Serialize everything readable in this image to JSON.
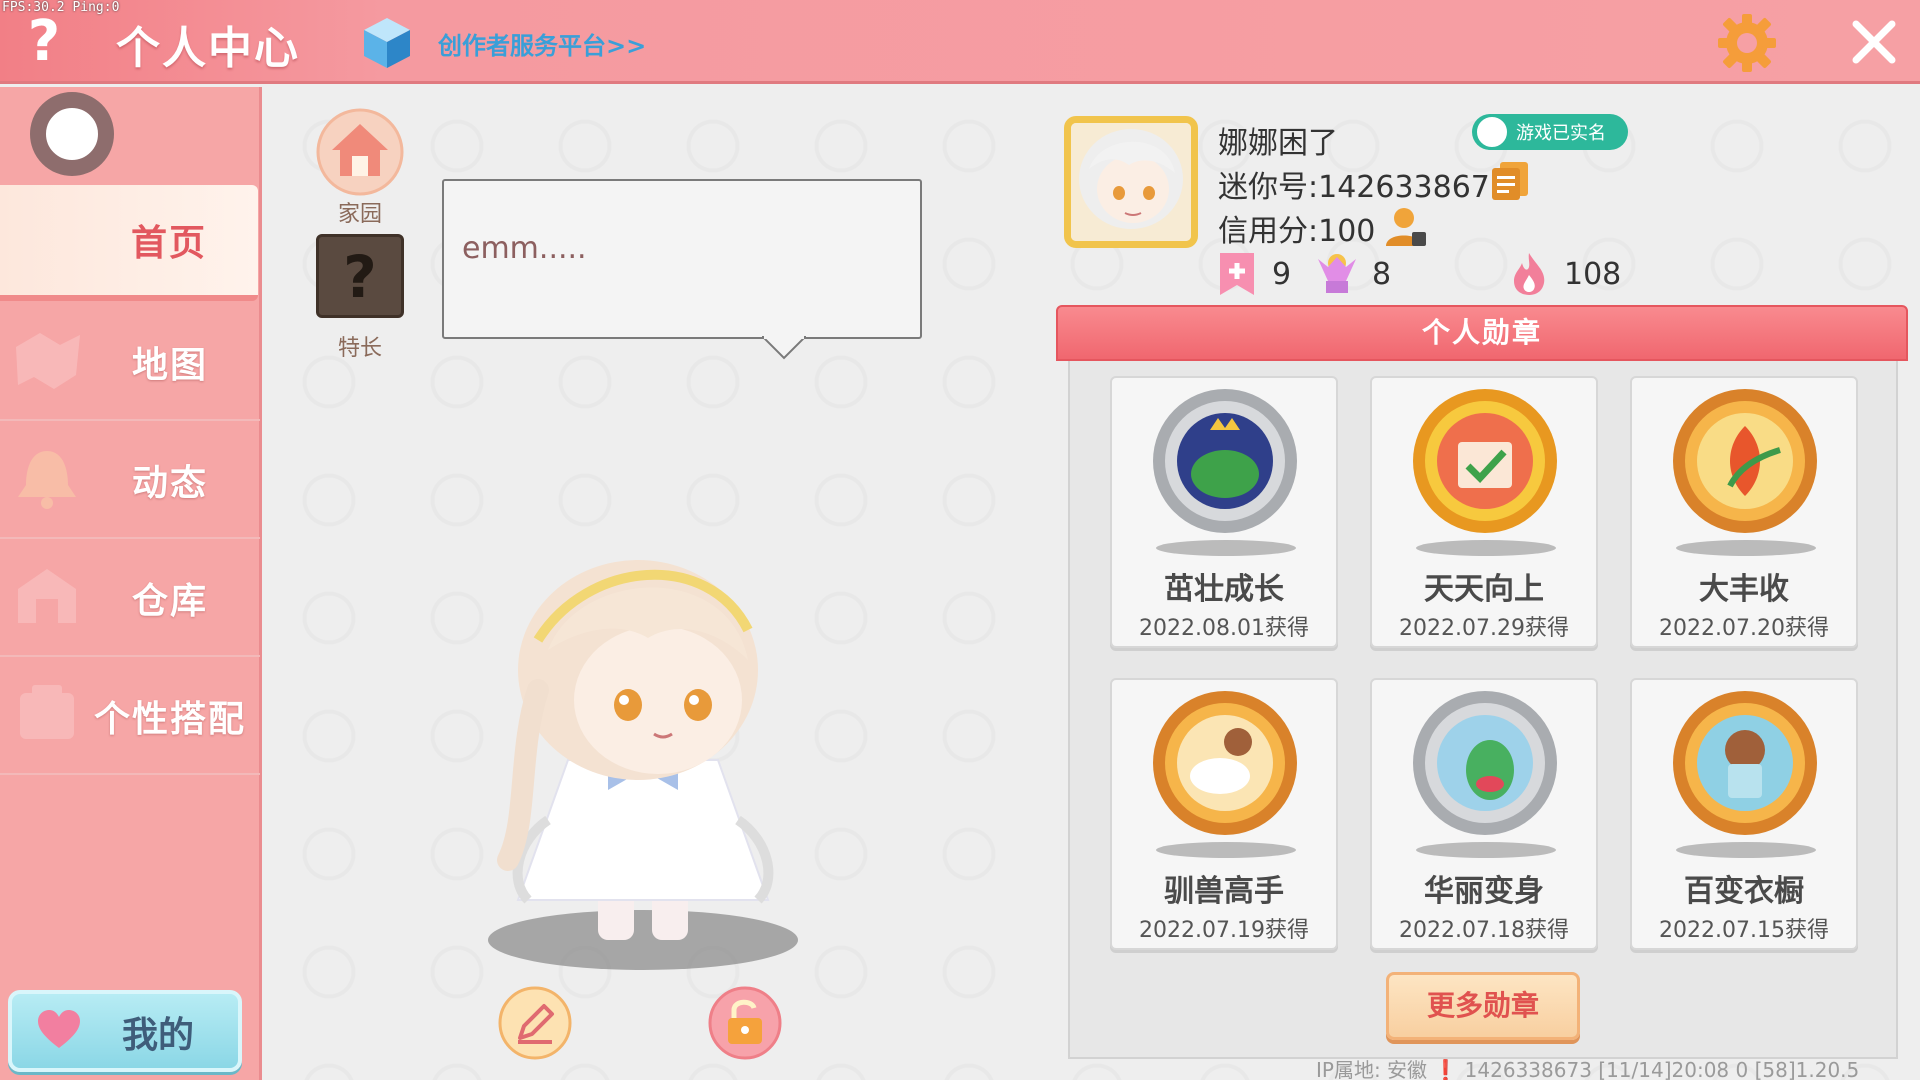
{
  "header": {
    "fps": "FPS:30.2  Ping:0",
    "help": "?",
    "title": "个人中心",
    "creator_link": "创作者服务平台>>"
  },
  "sidebar": {
    "items": [
      {
        "label": "首页",
        "icon": "home-page-icon",
        "active": true
      },
      {
        "label": "地图",
        "icon": "map-icon",
        "active": false
      },
      {
        "label": "动态",
        "icon": "bell-icon",
        "active": false
      },
      {
        "label": "仓库",
        "icon": "warehouse-icon",
        "active": false
      },
      {
        "label": "个性搭配",
        "icon": "outfit-icon",
        "active": false
      }
    ],
    "mine_label": "我的"
  },
  "stage": {
    "home_label": "家园",
    "skill_label": "特长",
    "skill_glyph": "?",
    "speech": "emm....."
  },
  "profile": {
    "nickname": "娜娜困了",
    "realname_badge": "游戏已实名",
    "mini_id": "迷你号:1426338673",
    "credit": "信用分:100",
    "stats": {
      "likes": "9",
      "fans": "8",
      "popularity": "108"
    }
  },
  "badges": {
    "header": "个人勋章",
    "items": [
      {
        "name": "茁壮成长",
        "date": "2022.08.01获得",
        "color": "#9aa0a6"
      },
      {
        "name": "天天向上",
        "date": "2022.07.29获得",
        "color": "#f2b233"
      },
      {
        "name": "大丰收",
        "date": "2022.07.20获得",
        "color": "#e8a24a"
      },
      {
        "name": "驯兽高手",
        "date": "2022.07.19获得",
        "color": "#e8a24a"
      },
      {
        "name": "华丽变身",
        "date": "2022.07.18获得",
        "color": "#9aa0a6"
      },
      {
        "name": "百变衣橱",
        "date": "2022.07.15获得",
        "color": "#e8a24a"
      }
    ],
    "more_label": "更多勋章"
  },
  "footer": {
    "info": "IP属地: 安徽 ❗   1426338673   [11/14]20:08 0  [58]1.20.5"
  },
  "colors": {
    "header_pink": "#f27f86",
    "sidebar_pink": "#f6a6a6",
    "active_text": "#e2585f",
    "link_blue": "#3a9fd8",
    "badge_header": "#f0676f"
  }
}
